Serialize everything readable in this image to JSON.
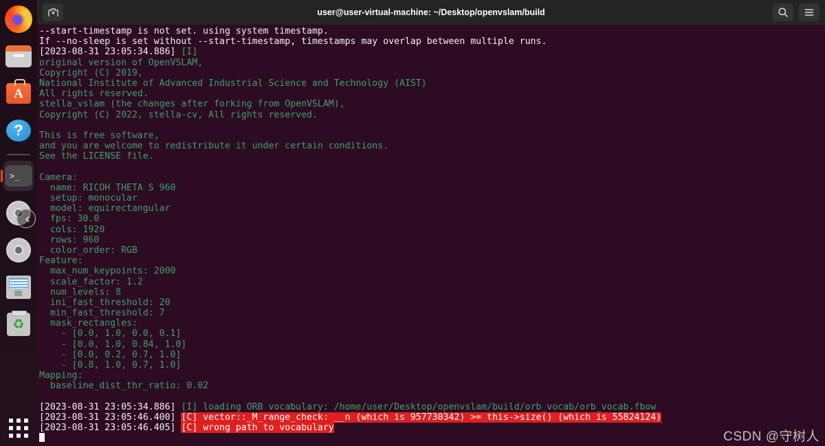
{
  "dock": {
    "items": [
      {
        "name": "firefox",
        "label": "Firefox Web Browser",
        "icon": "firefox-icon"
      },
      {
        "name": "files",
        "label": "Files",
        "icon": "files-icon"
      },
      {
        "name": "software",
        "label": "Ubuntu Software",
        "icon": "ubuntu-software-icon",
        "glyph": "A"
      },
      {
        "name": "help",
        "label": "Help",
        "icon": "help-icon",
        "glyph": "?"
      },
      {
        "name": "terminal",
        "label": "Terminal",
        "icon": "terminal-icon",
        "glyph": ">_",
        "active": true
      },
      {
        "name": "disc-eject",
        "label": "CD/DVD Drive",
        "icon": "disc-eject-icon"
      },
      {
        "name": "disc",
        "label": "CD/DVD Disc",
        "icon": "disc-icon"
      },
      {
        "name": "floppy",
        "label": "Floppy Disk",
        "icon": "floppy-disk-icon"
      },
      {
        "name": "trash",
        "label": "Trash",
        "icon": "trash-icon",
        "glyph": "♻"
      }
    ],
    "show_apps_label": "Show Applications"
  },
  "window": {
    "title": "user@user-virtual-machine: ~/Desktop/openvslam/build",
    "new_tab_label": "+",
    "search_icon": "search-icon",
    "menu_icon": "hamburger-menu-icon"
  },
  "terminal": {
    "lines": [
      {
        "segs": [
          {
            "t": "--start-timestamp is not set. using system timestamp.",
            "c": "white"
          }
        ]
      },
      {
        "segs": [
          {
            "t": "If --no-sleep is set without --start-timestamp, timestamps may overlap between multiple runs.",
            "c": "white"
          }
        ]
      },
      {
        "segs": [
          {
            "t": "[2023-08-31 23:05:34.886] ",
            "c": "white"
          },
          {
            "t": "[I]",
            "c": "green"
          }
        ]
      },
      {
        "segs": [
          {
            "t": "original version of OpenVSLAM,",
            "c": "green"
          }
        ]
      },
      {
        "segs": [
          {
            "t": "Copyright (C) 2019,",
            "c": "green"
          }
        ]
      },
      {
        "segs": [
          {
            "t": "National Institute of Advanced Industrial Science and Technology (AIST)",
            "c": "green"
          }
        ]
      },
      {
        "segs": [
          {
            "t": "All rights reserved.",
            "c": "green"
          }
        ]
      },
      {
        "segs": [
          {
            "t": "stella_vslam (the changes after forking from OpenVSLAM),",
            "c": "green"
          }
        ]
      },
      {
        "segs": [
          {
            "t": "Copyright (C) 2022, stella-cv, All rights reserved.",
            "c": "green"
          }
        ]
      },
      {
        "segs": [
          {
            "t": "",
            "c": "green"
          }
        ]
      },
      {
        "segs": [
          {
            "t": "This is free software,",
            "c": "green"
          }
        ]
      },
      {
        "segs": [
          {
            "t": "and you are welcome to redistribute it under certain conditions.",
            "c": "green"
          }
        ]
      },
      {
        "segs": [
          {
            "t": "See the LICENSE file.",
            "c": "green"
          }
        ]
      },
      {
        "segs": [
          {
            "t": "",
            "c": "green"
          }
        ]
      },
      {
        "segs": [
          {
            "t": "Camera:",
            "c": "green"
          }
        ]
      },
      {
        "segs": [
          {
            "t": "  name: RICOH THETA S 960",
            "c": "green"
          }
        ]
      },
      {
        "segs": [
          {
            "t": "  setup: monocular",
            "c": "green"
          }
        ]
      },
      {
        "segs": [
          {
            "t": "  model: equirectangular",
            "c": "green"
          }
        ]
      },
      {
        "segs": [
          {
            "t": "  fps: 30.0",
            "c": "green"
          }
        ]
      },
      {
        "segs": [
          {
            "t": "  cols: 1920",
            "c": "green"
          }
        ]
      },
      {
        "segs": [
          {
            "t": "  rows: 960",
            "c": "green"
          }
        ]
      },
      {
        "segs": [
          {
            "t": "  color_order: RGB",
            "c": "green"
          }
        ]
      },
      {
        "segs": [
          {
            "t": "Feature:",
            "c": "green"
          }
        ]
      },
      {
        "segs": [
          {
            "t": "  max_num_keypoints: 2000",
            "c": "green"
          }
        ]
      },
      {
        "segs": [
          {
            "t": "  scale_factor: 1.2",
            "c": "green"
          }
        ]
      },
      {
        "segs": [
          {
            "t": "  num_levels: 8",
            "c": "green"
          }
        ]
      },
      {
        "segs": [
          {
            "t": "  ini_fast_threshold: 20",
            "c": "green"
          }
        ]
      },
      {
        "segs": [
          {
            "t": "  min_fast_threshold: 7",
            "c": "green"
          }
        ]
      },
      {
        "segs": [
          {
            "t": "  mask_rectangles:",
            "c": "green"
          }
        ]
      },
      {
        "segs": [
          {
            "t": "    - [0.0, 1.0, 0.0, 0.1]",
            "c": "green"
          }
        ]
      },
      {
        "segs": [
          {
            "t": "    - [0.0, 1.0, 0.84, 1.0]",
            "c": "green"
          }
        ]
      },
      {
        "segs": [
          {
            "t": "    - [0.0, 0.2, 0.7, 1.0]",
            "c": "green"
          }
        ]
      },
      {
        "segs": [
          {
            "t": "    - [0.8, 1.0, 0.7, 1.0]",
            "c": "green"
          }
        ]
      },
      {
        "segs": [
          {
            "t": "Mapping:",
            "c": "green"
          }
        ]
      },
      {
        "segs": [
          {
            "t": "  baseline_dist_thr_ratio: 0.02",
            "c": "green"
          }
        ]
      },
      {
        "segs": [
          {
            "t": "",
            "c": "green"
          }
        ]
      },
      {
        "segs": [
          {
            "t": "[2023-08-31 23:05:34.886] ",
            "c": "white"
          },
          {
            "t": "[I] loading ORB vocabulary: /home/user/Desktop/openvslam/build/orb_vocab/orb_vocab.fbow",
            "c": "green"
          }
        ]
      },
      {
        "segs": [
          {
            "t": "[2023-08-31 23:05:46.400] ",
            "c": "white"
          },
          {
            "t": "[C] vector::_M_range_check: __n (which is 957730342) >= this->size() (which is 55824124)",
            "c": "redbg"
          }
        ]
      },
      {
        "segs": [
          {
            "t": "[2023-08-31 23:05:46.405] ",
            "c": "white"
          },
          {
            "t": "[C] wrong path to vocabulary",
            "c": "redbg"
          }
        ]
      },
      {
        "segs": [
          {
            "t": "",
            "c": "white"
          },
          {
            "cursor": true
          }
        ]
      }
    ]
  },
  "watermark": {
    "text": "CSDN @守树人"
  },
  "colors": {
    "terminal_bg": "#2d0b22",
    "titlebar_bg": "#242424",
    "green": "#40a06c",
    "white": "#f2f2f2",
    "error_bg": "#e02020",
    "accent": "#e95420"
  }
}
